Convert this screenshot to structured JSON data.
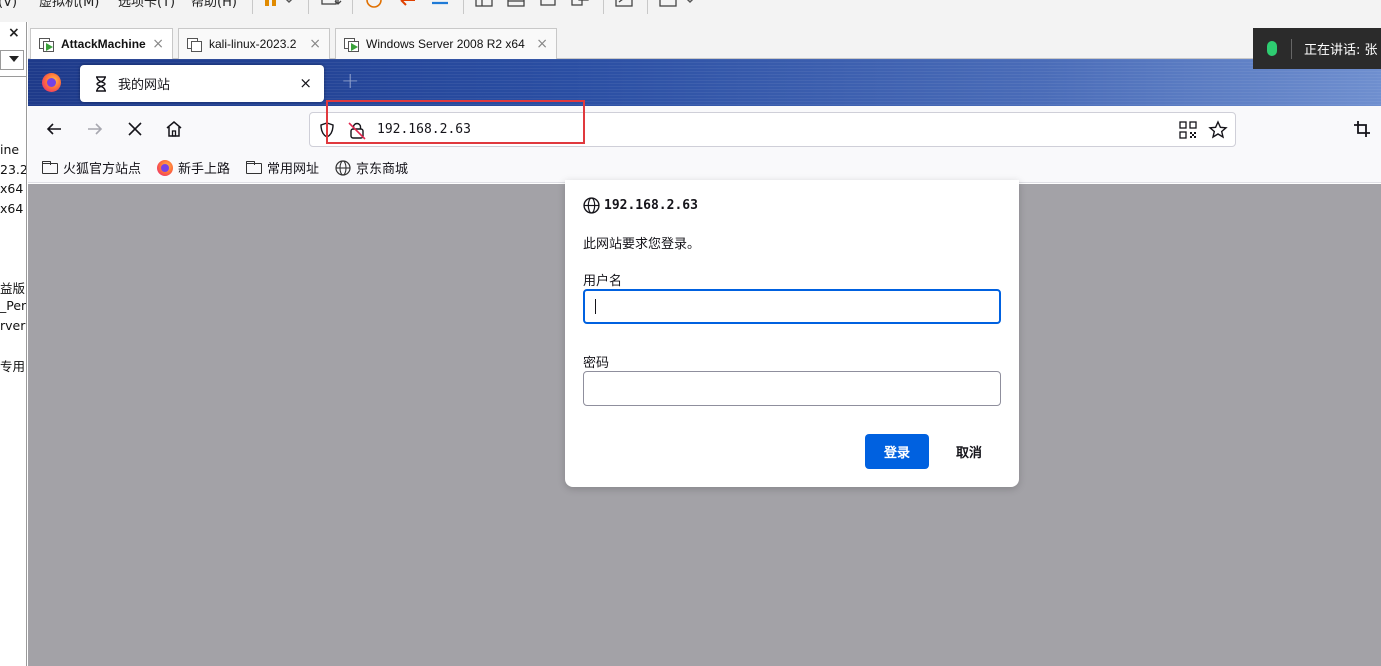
{
  "vm": {
    "menu": [
      "查看(V)",
      "虚拟机(M)",
      "选项卡(T)",
      "帮助(H)"
    ],
    "library_left_text": [
      "ine",
      "23.2",
      "x64",
      " x64",
      "益版",
      "_Per",
      "rver",
      "专用)"
    ],
    "tabs": [
      {
        "label": "AttackMachine",
        "active": true
      },
      {
        "label": "kali-linux-2023.2",
        "active": false
      },
      {
        "label": "Windows Server 2008 R2 x64",
        "active": false
      }
    ],
    "tab_close": "×",
    "left_close": "×"
  },
  "voice": {
    "label": "正在讲话: 张",
    "mic_color": "#2ecc71"
  },
  "browser": {
    "tab_title": "我的网站",
    "tab_close": "×",
    "new_tab": "+",
    "url": "192.168.2.63",
    "url_highlight_color": "#e0393e",
    "bookmarks": [
      {
        "label": "火狐官方站点",
        "icon": "folder-icon"
      },
      {
        "label": "新手上路",
        "icon": "firefox-icon"
      },
      {
        "label": "常用网址",
        "icon": "folder-icon"
      },
      {
        "label": "京东商城",
        "icon": "globe-icon"
      }
    ]
  },
  "auth_dialog": {
    "origin": "192.168.2.63",
    "message": "此网站要求您登录。",
    "username_label": "用户名",
    "username_value": "",
    "password_label": "密码",
    "password_value": "",
    "ok_label": "登录",
    "cancel_label": "取消",
    "accent_color": "#0061e0"
  }
}
